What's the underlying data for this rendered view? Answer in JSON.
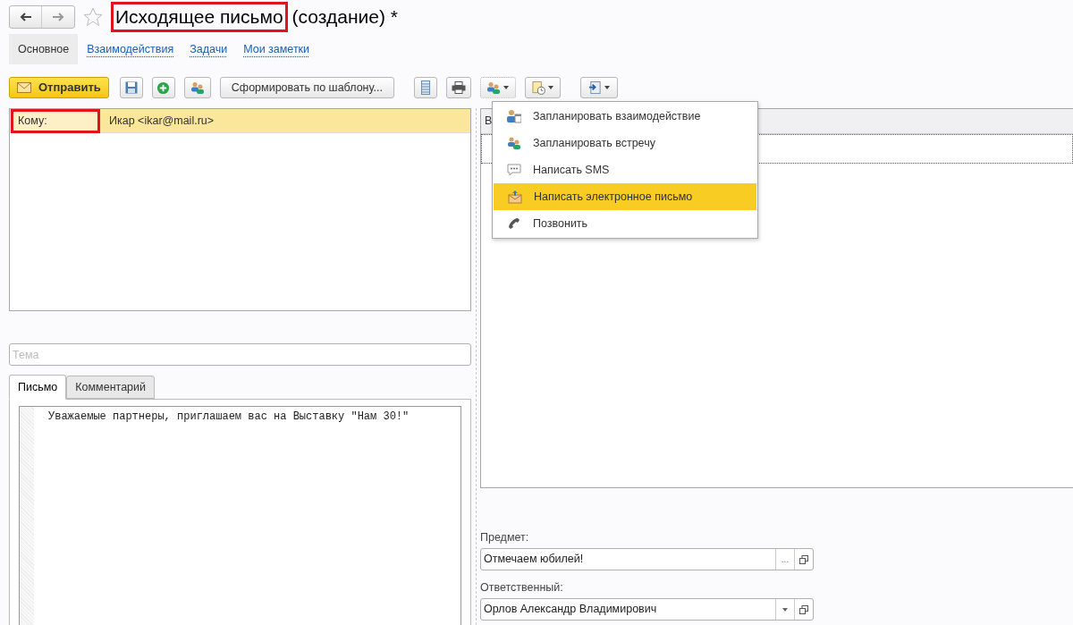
{
  "window": {
    "title": "Исходящее письмо",
    "title_suffix": "(создание) *"
  },
  "section_tabs": [
    {
      "label": "Основное",
      "selected": true
    },
    {
      "label": "Взаимодействия",
      "selected": false
    },
    {
      "label": "Задачи",
      "selected": false
    },
    {
      "label": "Мои заметки",
      "selected": false
    }
  ],
  "toolbar": {
    "send": "Отправить",
    "template": "Сформировать по шаблону..."
  },
  "recipients": [
    {
      "label": "Кому:",
      "value": "Икар <ikar@mail.ru>",
      "selected": true
    }
  ],
  "subject_field": {
    "placeholder": "Тема"
  },
  "body_tabs": [
    {
      "label": "Письмо",
      "selected": true
    },
    {
      "label": "Комментарий",
      "selected": false
    }
  ],
  "body_text": "Уважаемые партнеры, приглашаем вас на Выставку \"Нам 30!\"",
  "right_panel": {
    "column_1": "В"
  },
  "menu": [
    {
      "kind": "interaction",
      "label": "Запланировать взаимодействие",
      "selected": false
    },
    {
      "kind": "meeting",
      "label": "Запланировать встречу",
      "selected": false
    },
    {
      "kind": "sms",
      "label": "Написать SMS",
      "selected": false
    },
    {
      "kind": "email",
      "label": "Написать электронное письмо",
      "selected": true
    },
    {
      "kind": "call",
      "label": "Позвонить",
      "selected": false
    }
  ],
  "fields": [
    {
      "kind": "choice",
      "label": "Предмет:",
      "value": "Отмечаем юбилей!",
      "button": "..."
    },
    {
      "kind": "dropdown",
      "label": "Ответственный:",
      "value": "Орлов Александр Владимирович"
    }
  ]
}
